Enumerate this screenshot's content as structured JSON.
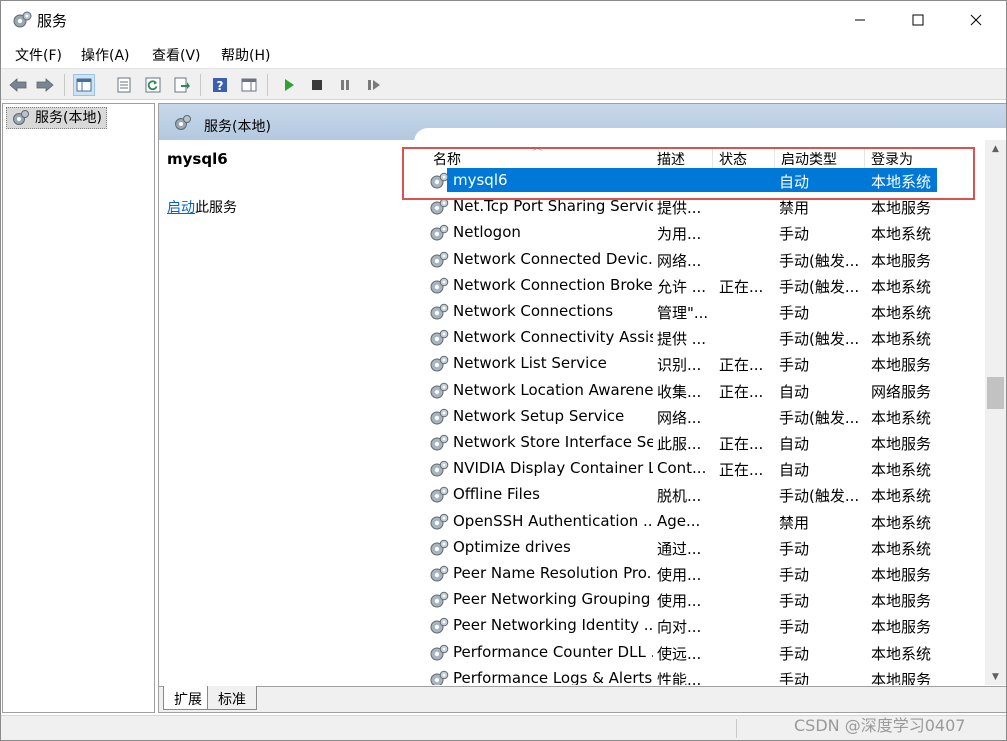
{
  "window": {
    "title": "服务",
    "controls": {
      "minimize": "—",
      "maximize": "☐",
      "close": "✕"
    }
  },
  "menu": [
    "文件(F)",
    "操作(A)",
    "查看(V)",
    "帮助(H)"
  ],
  "tree": {
    "root_label": "服务(本地)"
  },
  "content": {
    "header_title": "服务(本地)",
    "selected_service": "mysql6",
    "action_link": "启动",
    "action_suffix": "此服务"
  },
  "columns": [
    "名称",
    "描述",
    "状态",
    "启动类型",
    "登录为"
  ],
  "services": [
    {
      "name": "mysql6",
      "desc": "",
      "status": "",
      "startup": "自动",
      "logon": "本地系统",
      "selected": true
    },
    {
      "name": "Net.Tcp Port Sharing Service",
      "desc": "提供...",
      "status": "",
      "startup": "禁用",
      "logon": "本地服务"
    },
    {
      "name": "Netlogon",
      "desc": "为用...",
      "status": "",
      "startup": "手动",
      "logon": "本地系统"
    },
    {
      "name": "Network Connected Devic...",
      "desc": "网络...",
      "status": "",
      "startup": "手动(触发...",
      "logon": "本地服务"
    },
    {
      "name": "Network Connection Broker",
      "desc": "允许 ...",
      "status": "正在...",
      "startup": "手动(触发...",
      "logon": "本地系统"
    },
    {
      "name": "Network Connections",
      "desc": "管理\"...",
      "status": "",
      "startup": "手动",
      "logon": "本地系统"
    },
    {
      "name": "Network Connectivity Assis...",
      "desc": "提供 ...",
      "status": "",
      "startup": "手动(触发...",
      "logon": "本地系统"
    },
    {
      "name": "Network List Service",
      "desc": "识别...",
      "status": "正在...",
      "startup": "手动",
      "logon": "本地服务"
    },
    {
      "name": "Network Location Awarene...",
      "desc": "收集...",
      "status": "正在...",
      "startup": "自动",
      "logon": "网络服务"
    },
    {
      "name": "Network Setup Service",
      "desc": "网络...",
      "status": "",
      "startup": "手动(触发...",
      "logon": "本地系统"
    },
    {
      "name": "Network Store Interface Se...",
      "desc": "此服...",
      "status": "正在...",
      "startup": "自动",
      "logon": "本地服务"
    },
    {
      "name": "NVIDIA Display Container LS",
      "desc": "Cont...",
      "status": "正在...",
      "startup": "自动",
      "logon": "本地系统"
    },
    {
      "name": "Offline Files",
      "desc": "脱机...",
      "status": "",
      "startup": "手动(触发...",
      "logon": "本地系统"
    },
    {
      "name": "OpenSSH Authentication ...",
      "desc": "Age...",
      "status": "",
      "startup": "禁用",
      "logon": "本地系统"
    },
    {
      "name": "Optimize drives",
      "desc": "通过...",
      "status": "",
      "startup": "手动",
      "logon": "本地系统"
    },
    {
      "name": "Peer Name Resolution Pro...",
      "desc": "使用...",
      "status": "",
      "startup": "手动",
      "logon": "本地服务"
    },
    {
      "name": "Peer Networking Grouping",
      "desc": "使用...",
      "status": "",
      "startup": "手动",
      "logon": "本地服务"
    },
    {
      "name": "Peer Networking Identity ...",
      "desc": "向对...",
      "status": "",
      "startup": "手动",
      "logon": "本地服务"
    },
    {
      "name": "Performance Counter DLL ...",
      "desc": "使远...",
      "status": "",
      "startup": "手动",
      "logon": "本地系统"
    },
    {
      "name": "Performance Logs & Alerts",
      "desc": "性能...",
      "status": "",
      "startup": "手动",
      "logon": "本地服务"
    }
  ],
  "tabs": [
    "扩展",
    "标准"
  ],
  "watermark": "CSDN @深度学习0407",
  "colors": {
    "selection": "#0078d7",
    "annotation": "#d9534f",
    "link": "#0066cc"
  }
}
